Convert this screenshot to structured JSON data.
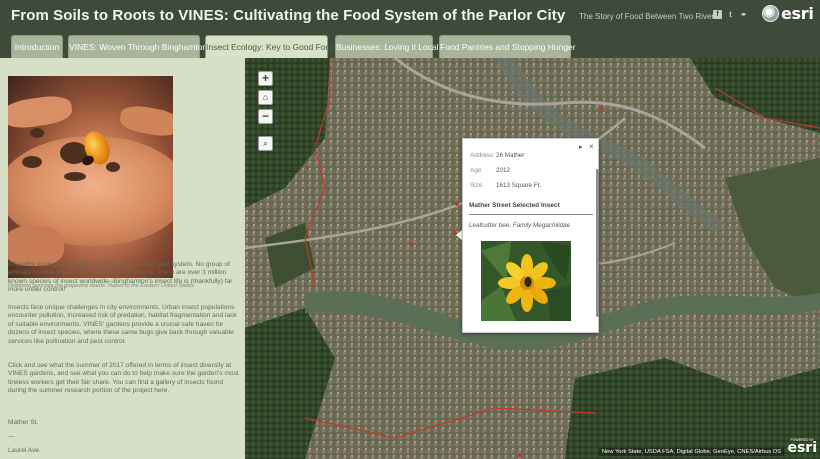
{
  "header": {
    "title": "From Soils to Roots to VINES: Cultivating the Food System of the Parlor City",
    "subtitle": "The Story of Food Between Two Rivers",
    "social": {
      "facebook": "f",
      "twitter": "t",
      "link": "⚭"
    },
    "brand": "esri"
  },
  "tabs": [
    {
      "label": "Introduction",
      "active": false
    },
    {
      "label": "VINES: Woven Through Binghamton",
      "active": false
    },
    {
      "label": "Insect Ecology: Key to Good Food",
      "active": true
    },
    {
      "label": "Businesses: Loving it Local",
      "active": false
    },
    {
      "label": "Food Pantries and Stopping Hunger",
      "active": false
    }
  ],
  "panel": {
    "photo_caption": "Pelidnota punctata the grapevine beetle. Native to the Eastern United States",
    "paragraphs": [
      "A healthy ecology is essential to a healthy, thriving food system. No group of animals is more important to both than the insects. There are over 3 million known species of insect worldwide--Binghamton's insect life is (thankfully) far more under control!",
      "Insects face unique challenges in city environments. Urban insect populations encounter pollution, increased risk of predation, habitat fragmentation and lack of suitable environments. VINES' gardens provide a crucial safe haven for dozens of insect species, where these same bugs give back through valuable services like pollination and pest control.",
      "Click and see what the summer of 2017 offered in terms of insect diversity at VINES gardens, and see what you can do to help make sure the garden's most tireless workers get their fair share. You can find a gallery of insects found during the summer research portion of the project here."
    ],
    "list": [
      "Mather St.",
      "---",
      "Laurel Ave."
    ]
  },
  "map": {
    "zoom_in": "+",
    "zoom_out": "−",
    "home": "⌂",
    "search": "⌕",
    "attribution": "New York State, USDA FSA, Digital Globe, GeoEye, CNES/Airbus DS",
    "powered_by": "POWERED BY",
    "brand": "esri"
  },
  "popup": {
    "controls": {
      "next": "▸",
      "close": "×"
    },
    "fields": [
      {
        "key": "Address",
        "value": "26 Mather"
      },
      {
        "key": "Age",
        "value": "2012"
      },
      {
        "key": "Size",
        "value": "1613 Square Ft."
      }
    ],
    "title": "Mather Street Selected Insect",
    "description": "Leafcutter bee, Family Megachilidae"
  },
  "colors": {
    "header_bg": "#3e4b3b",
    "panel_bg": "#d7e0c7",
    "tab_bg": "#a9b59a",
    "tab_active_bg": "#d9e2c9",
    "boundary": "#c0392b"
  }
}
